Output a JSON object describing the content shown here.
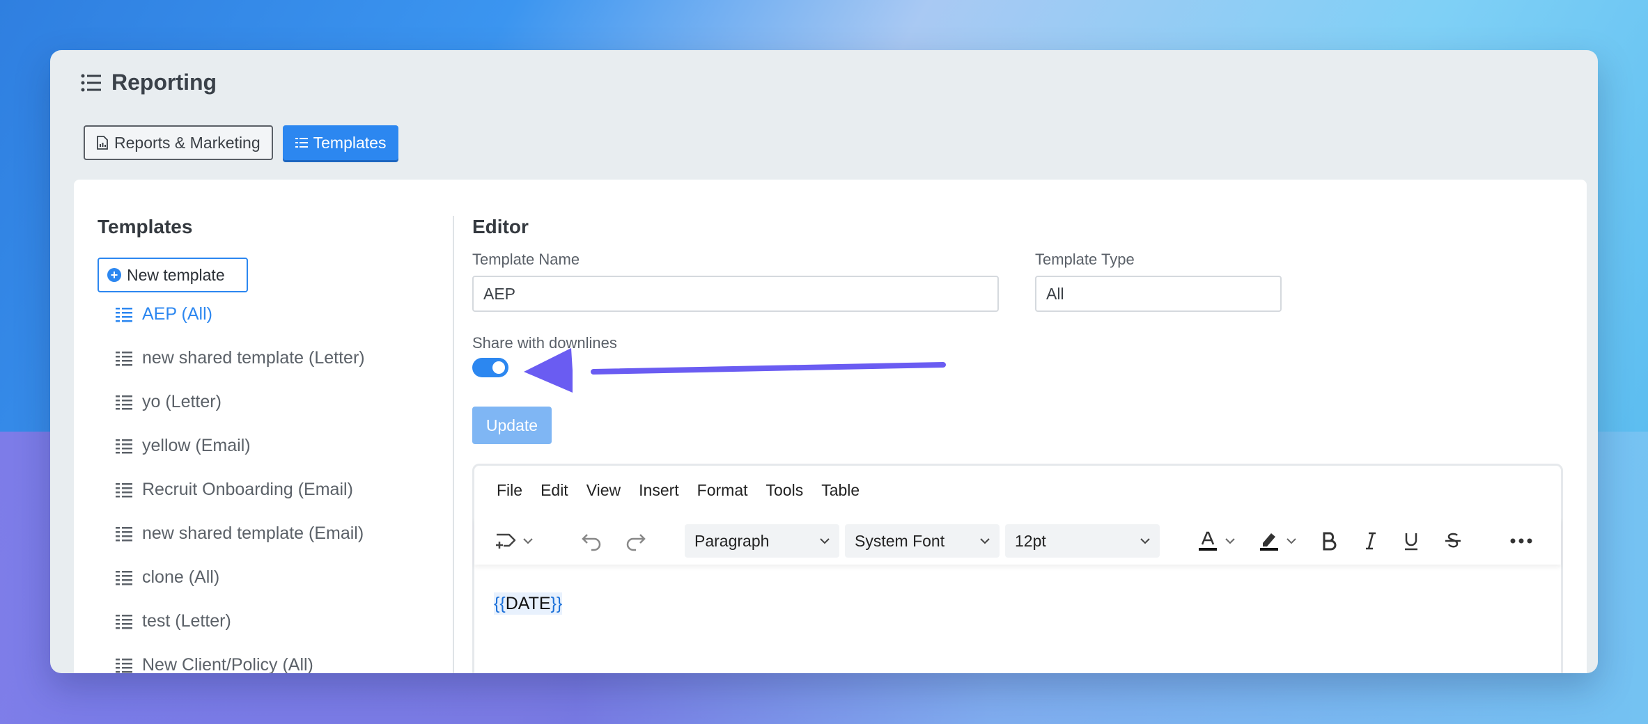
{
  "app": {
    "title": "Reporting"
  },
  "tabs": [
    {
      "label": "Reports & Marketing",
      "icon": "file-chart-icon",
      "active": false
    },
    {
      "label": "Templates",
      "icon": "list-icon",
      "active": true
    }
  ],
  "sidebar": {
    "title": "Templates",
    "new_button": "New template",
    "items": [
      {
        "label": "AEP (All)",
        "selected": true
      },
      {
        "label": "new shared template (Letter)"
      },
      {
        "label": "yo (Letter)"
      },
      {
        "label": "yellow (Email)"
      },
      {
        "label": "Recruit Onboarding (Email)"
      },
      {
        "label": "new shared template (Email)"
      },
      {
        "label": "clone (All)"
      },
      {
        "label": "test (Letter)"
      },
      {
        "label": "New Client/Policy (All)"
      }
    ]
  },
  "editor": {
    "title": "Editor",
    "name_label": "Template Name",
    "name_value": "AEP",
    "type_label": "Template Type",
    "type_value": "All",
    "share_label": "Share with downlines",
    "share_enabled": true,
    "update_button": "Update",
    "menu": [
      "File",
      "Edit",
      "View",
      "Insert",
      "Format",
      "Tools",
      "Table"
    ],
    "block_format": "Paragraph",
    "font_family": "System Font",
    "font_size": "12pt",
    "content": {
      "open_brace": "{{",
      "variable": "DATE",
      "close_brace": "}}"
    }
  },
  "colors": {
    "accent": "#2c87f0",
    "annotation_arrow": "#6a5cf2"
  }
}
